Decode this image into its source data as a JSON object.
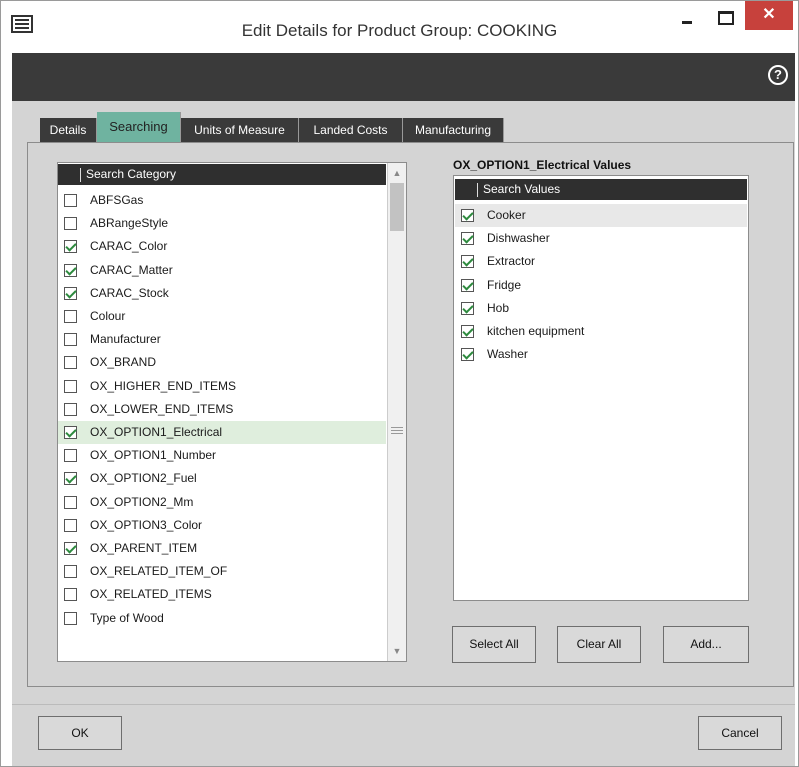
{
  "window": {
    "title": "Edit Details for Product Group: COOKING",
    "close_glyph": "✕",
    "help_glyph": "?"
  },
  "tabs": [
    {
      "label": "Details",
      "active": false
    },
    {
      "label": "Searching",
      "active": true
    },
    {
      "label": "Units of Measure",
      "active": false
    },
    {
      "label": "Landed Costs",
      "active": false
    },
    {
      "label": "Manufacturing",
      "active": false
    }
  ],
  "categories": {
    "header": "Search Category",
    "items": [
      {
        "label": "ABFSGas",
        "checked": false
      },
      {
        "label": "ABRangeStyle",
        "checked": false
      },
      {
        "label": "CARAC_Color",
        "checked": true
      },
      {
        "label": "CARAC_Matter",
        "checked": true
      },
      {
        "label": "CARAC_Stock",
        "checked": true
      },
      {
        "label": "Colour",
        "checked": false
      },
      {
        "label": "Manufacturer",
        "checked": false
      },
      {
        "label": "OX_BRAND",
        "checked": false
      },
      {
        "label": "OX_HIGHER_END_ITEMS",
        "checked": false
      },
      {
        "label": "OX_LOWER_END_ITEMS",
        "checked": false
      },
      {
        "label": "OX_OPTION1_Electrical",
        "checked": true,
        "selected": true
      },
      {
        "label": "OX_OPTION1_Number",
        "checked": false
      },
      {
        "label": "OX_OPTION2_Fuel",
        "checked": true
      },
      {
        "label": "OX_OPTION2_Mm",
        "checked": false
      },
      {
        "label": "OX_OPTION3_Color",
        "checked": false
      },
      {
        "label": "OX_PARENT_ITEM",
        "checked": true
      },
      {
        "label": "OX_RELATED_ITEM_OF",
        "checked": false
      },
      {
        "label": "OX_RELATED_ITEMS",
        "checked": false
      },
      {
        "label": "Type of Wood",
        "checked": false
      }
    ]
  },
  "values": {
    "title": "OX_OPTION1_Electrical Values",
    "header": "Search Values",
    "items": [
      {
        "label": "Cooker",
        "checked": true,
        "highlight": true
      },
      {
        "label": "Dishwasher",
        "checked": true
      },
      {
        "label": "Extractor",
        "checked": true
      },
      {
        "label": "Fridge",
        "checked": true
      },
      {
        "label": "Hob",
        "checked": true
      },
      {
        "label": "kitchen equipment",
        "checked": true
      },
      {
        "label": "Washer",
        "checked": true
      }
    ]
  },
  "buttons": {
    "select_all": "Select All",
    "clear_all": "Clear All",
    "add": "Add...",
    "ok": "OK",
    "cancel": "Cancel"
  },
  "colors": {
    "active_tab": "#6fb3a0",
    "close_button": "#c7413c",
    "dark_bar": "#3a3a3a",
    "checkmark": "#2d8a3e"
  }
}
